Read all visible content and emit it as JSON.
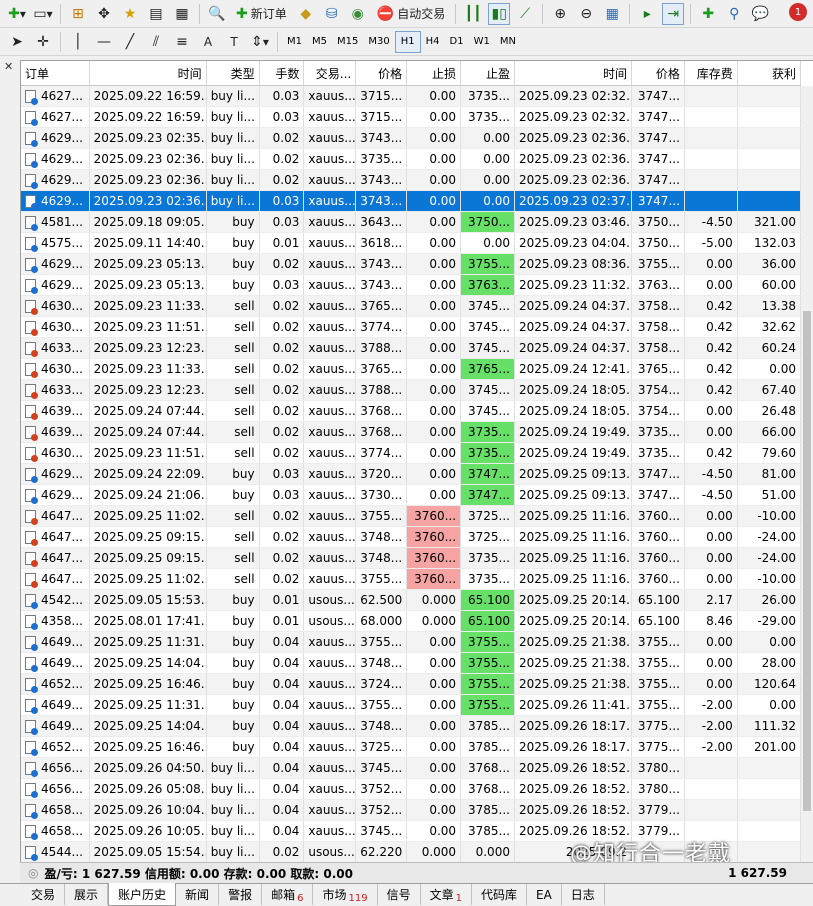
{
  "toolbar": {
    "new_order": "新订单",
    "auto_trading": "自动交易",
    "notification_count": "1",
    "timeframes": [
      "M1",
      "M5",
      "M15",
      "M30",
      "H1",
      "H4",
      "D1",
      "W1",
      "MN"
    ],
    "active_timeframe": "H1"
  },
  "table": {
    "headers": [
      "订单",
      "时间",
      "类型",
      "手数",
      "交易...",
      "价格",
      "止损",
      "止盈",
      "时间",
      "价格",
      "库存费",
      "获利"
    ],
    "rows": [
      {
        "side": "pend",
        "cells": [
          "4627...",
          "2025.09.22 16:59...",
          "buy li...",
          "0.03",
          "xauus...",
          "3715...",
          "0.00",
          "3735...",
          "2025.09.23 02:32...",
          "3747...",
          "",
          ""
        ]
      },
      {
        "side": "pend",
        "cells": [
          "4627...",
          "2025.09.22 16:59...",
          "buy li...",
          "0.03",
          "xauus...",
          "3715...",
          "0.00",
          "3735...",
          "2025.09.23 02:32...",
          "3747...",
          "",
          ""
        ]
      },
      {
        "side": "pend",
        "cells": [
          "4629...",
          "2025.09.23 02:35...",
          "buy li...",
          "0.02",
          "xauus...",
          "3743...",
          "0.00",
          "0.00",
          "2025.09.23 02:36...",
          "3747...",
          "",
          ""
        ]
      },
      {
        "side": "pend",
        "cells": [
          "4629...",
          "2025.09.23 02:36...",
          "buy li...",
          "0.02",
          "xauus...",
          "3735...",
          "0.00",
          "0.00",
          "2025.09.23 02:36...",
          "3747...",
          "",
          ""
        ]
      },
      {
        "side": "pend",
        "cells": [
          "4629...",
          "2025.09.23 02:36...",
          "buy li...",
          "0.02",
          "xauus...",
          "3743...",
          "0.00",
          "0.00",
          "2025.09.23 02:36...",
          "3747...",
          "",
          ""
        ]
      },
      {
        "side": "pend",
        "selected": true,
        "cells": [
          "4629...",
          "2025.09.23 02:36...",
          "buy li...",
          "0.03",
          "xauus...",
          "3743...",
          "0.00",
          "0.00",
          "2025.09.23 02:37...",
          "3747...",
          "",
          ""
        ]
      },
      {
        "side": "buy",
        "tp": "green",
        "cells": [
          "4581...",
          "2025.09.18 09:05...",
          "buy",
          "0.03",
          "xauus...",
          "3643...",
          "0.00",
          "3750...",
          "2025.09.23 03:46...",
          "3750...",
          "-4.50",
          "321.00"
        ]
      },
      {
        "side": "buy",
        "cells": [
          "4575...",
          "2025.09.11 14:40...",
          "buy",
          "0.01",
          "xauus...",
          "3618...",
          "0.00",
          "0.00",
          "2025.09.23 04:04...",
          "3750...",
          "-5.00",
          "132.03"
        ]
      },
      {
        "side": "buy",
        "tp": "green",
        "cells": [
          "4629...",
          "2025.09.23 05:13...",
          "buy",
          "0.02",
          "xauus...",
          "3743...",
          "0.00",
          "3755...",
          "2025.09.23 08:36...",
          "3755...",
          "0.00",
          "36.00"
        ]
      },
      {
        "side": "buy",
        "tp": "green",
        "cells": [
          "4629...",
          "2025.09.23 05:13...",
          "buy",
          "0.03",
          "xauus...",
          "3743...",
          "0.00",
          "3763...",
          "2025.09.23 11:32...",
          "3763...",
          "0.00",
          "60.00"
        ]
      },
      {
        "side": "sell",
        "cells": [
          "4630...",
          "2025.09.23 11:33...",
          "sell",
          "0.02",
          "xauus...",
          "3765...",
          "0.00",
          "3745...",
          "2025.09.24 04:37...",
          "3758...",
          "0.42",
          "13.38"
        ]
      },
      {
        "side": "sell",
        "cells": [
          "4630...",
          "2025.09.23 11:51...",
          "sell",
          "0.02",
          "xauus...",
          "3774...",
          "0.00",
          "3745...",
          "2025.09.24 04:37...",
          "3758...",
          "0.42",
          "32.62"
        ]
      },
      {
        "side": "sell",
        "cells": [
          "4633...",
          "2025.09.23 12:23...",
          "sell",
          "0.02",
          "xauus...",
          "3788...",
          "0.00",
          "3745...",
          "2025.09.24 04:37...",
          "3758...",
          "0.42",
          "60.24"
        ]
      },
      {
        "side": "sell",
        "tp": "green",
        "cells": [
          "4630...",
          "2025.09.23 11:33...",
          "sell",
          "0.02",
          "xauus...",
          "3765...",
          "0.00",
          "3765...",
          "2025.09.24 12:41...",
          "3765...",
          "0.42",
          "0.00"
        ]
      },
      {
        "side": "sell",
        "cells": [
          "4633...",
          "2025.09.23 12:23...",
          "sell",
          "0.02",
          "xauus...",
          "3788...",
          "0.00",
          "3745...",
          "2025.09.24 18:05...",
          "3754...",
          "0.42",
          "67.40"
        ]
      },
      {
        "side": "sell",
        "cells": [
          "4639...",
          "2025.09.24 07:44...",
          "sell",
          "0.02",
          "xauus...",
          "3768...",
          "0.00",
          "3745...",
          "2025.09.24 18:05...",
          "3754...",
          "0.00",
          "26.48"
        ]
      },
      {
        "side": "sell",
        "tp": "green",
        "cells": [
          "4639...",
          "2025.09.24 07:44...",
          "sell",
          "0.02",
          "xauus...",
          "3768...",
          "0.00",
          "3735...",
          "2025.09.24 19:49...",
          "3735...",
          "0.00",
          "66.00"
        ]
      },
      {
        "side": "sell",
        "tp": "green",
        "cells": [
          "4630...",
          "2025.09.23 11:51...",
          "sell",
          "0.02",
          "xauus...",
          "3774...",
          "0.00",
          "3735...",
          "2025.09.24 19:49...",
          "3735...",
          "0.42",
          "79.60"
        ]
      },
      {
        "side": "buy",
        "tp": "green",
        "cells": [
          "4629...",
          "2025.09.24 22:09...",
          "buy",
          "0.03",
          "xauus...",
          "3720...",
          "0.00",
          "3747...",
          "2025.09.25 09:13...",
          "3747...",
          "-4.50",
          "81.00"
        ]
      },
      {
        "side": "buy",
        "tp": "green",
        "cells": [
          "4629...",
          "2025.09.24 21:06...",
          "buy",
          "0.03",
          "xauus...",
          "3730...",
          "0.00",
          "3747...",
          "2025.09.25 09:13...",
          "3747...",
          "-4.50",
          "51.00"
        ]
      },
      {
        "side": "sell",
        "sl": "red",
        "cells": [
          "4647...",
          "2025.09.25 11:02...",
          "sell",
          "0.02",
          "xauus...",
          "3755...",
          "3760...",
          "3725...",
          "2025.09.25 11:16...",
          "3760...",
          "0.00",
          "-10.00"
        ]
      },
      {
        "side": "sell",
        "sl": "red",
        "cells": [
          "4647...",
          "2025.09.25 09:15...",
          "sell",
          "0.02",
          "xauus...",
          "3748...",
          "3760...",
          "3725...",
          "2025.09.25 11:16...",
          "3760...",
          "0.00",
          "-24.00"
        ]
      },
      {
        "side": "sell",
        "sl": "red",
        "cells": [
          "4647...",
          "2025.09.25 09:15...",
          "sell",
          "0.02",
          "xauus...",
          "3748...",
          "3760...",
          "3735...",
          "2025.09.25 11:16...",
          "3760...",
          "0.00",
          "-24.00"
        ]
      },
      {
        "side": "sell",
        "sl": "red",
        "cells": [
          "4647...",
          "2025.09.25 11:02...",
          "sell",
          "0.02",
          "xauus...",
          "3755...",
          "3760...",
          "3735...",
          "2025.09.25 11:16...",
          "3760...",
          "0.00",
          "-10.00"
        ]
      },
      {
        "side": "buy",
        "tp": "green",
        "cells": [
          "4542...",
          "2025.09.05 15:53...",
          "buy",
          "0.01",
          "usous...",
          "62.500",
          "0.000",
          "65.100",
          "2025.09.25 20:14...",
          "65.100",
          "2.17",
          "26.00"
        ]
      },
      {
        "side": "buy",
        "tp": "green",
        "cells": [
          "4358...",
          "2025.08.01 17:41...",
          "buy",
          "0.01",
          "usous...",
          "68.000",
          "0.000",
          "65.100",
          "2025.09.25 20:14...",
          "65.100",
          "8.46",
          "-29.00"
        ]
      },
      {
        "side": "buy",
        "tp": "green",
        "cells": [
          "4649...",
          "2025.09.25 11:31...",
          "buy",
          "0.04",
          "xauus...",
          "3755...",
          "0.00",
          "3755...",
          "2025.09.25 21:38...",
          "3755...",
          "0.00",
          "0.00"
        ]
      },
      {
        "side": "buy",
        "tp": "green",
        "cells": [
          "4649...",
          "2025.09.25 14:04...",
          "buy",
          "0.04",
          "xauus...",
          "3748...",
          "0.00",
          "3755...",
          "2025.09.25 21:38...",
          "3755...",
          "0.00",
          "28.00"
        ]
      },
      {
        "side": "buy",
        "tp": "green",
        "cells": [
          "4652...",
          "2025.09.25 16:46...",
          "buy",
          "0.04",
          "xauus...",
          "3724...",
          "0.00",
          "3755...",
          "2025.09.25 21:38...",
          "3755...",
          "0.00",
          "120.64"
        ]
      },
      {
        "side": "buy",
        "tp": "green",
        "cells": [
          "4649...",
          "2025.09.25 11:31...",
          "buy",
          "0.04",
          "xauus...",
          "3755...",
          "0.00",
          "3755...",
          "2025.09.26 11:41...",
          "3755...",
          "-2.00",
          "0.00"
        ]
      },
      {
        "side": "buy",
        "cells": [
          "4649...",
          "2025.09.25 14:04...",
          "buy",
          "0.04",
          "xauus...",
          "3748...",
          "0.00",
          "3785...",
          "2025.09.26 18:17...",
          "3775...",
          "-2.00",
          "111.32"
        ]
      },
      {
        "side": "buy",
        "cells": [
          "4652...",
          "2025.09.25 16:46...",
          "buy",
          "0.04",
          "xauus...",
          "3725...",
          "0.00",
          "3785...",
          "2025.09.26 18:17...",
          "3775...",
          "-2.00",
          "201.00"
        ]
      },
      {
        "side": "pend",
        "cells": [
          "4656...",
          "2025.09.26 04:50...",
          "buy li...",
          "0.04",
          "xauus...",
          "3745...",
          "0.00",
          "3768...",
          "2025.09.26 18:52...",
          "3780...",
          "",
          ""
        ]
      },
      {
        "side": "pend",
        "cells": [
          "4656...",
          "2025.09.26 05:08...",
          "buy li...",
          "0.04",
          "xauus...",
          "3752...",
          "0.00",
          "3768...",
          "2025.09.26 18:52...",
          "3780...",
          "",
          ""
        ]
      },
      {
        "side": "pend",
        "cells": [
          "4658...",
          "2025.09.26 10:04...",
          "buy li...",
          "0.04",
          "xauus...",
          "3752...",
          "0.00",
          "3785...",
          "2025.09.26 18:52...",
          "3779...",
          "",
          ""
        ]
      },
      {
        "side": "pend",
        "cells": [
          "4658...",
          "2025.09.26 10:05...",
          "buy li...",
          "0.04",
          "xauus...",
          "3745...",
          "0.00",
          "3785...",
          "2025.09.26 18:52...",
          "3779...",
          "",
          ""
        ]
      },
      {
        "side": "pend",
        "cells": [
          "4544...",
          "2025.09.05 15:54...",
          "buy li...",
          "0.02",
          "usous...",
          "62.220",
          "0.000",
          "0.000",
          "2025.09.2",
          "",
          "",
          ""
        ]
      }
    ]
  },
  "status": {
    "summary": "盈/亏: 1 627.59  信用额: 0.00  存款: 0.00  取款: 0.00",
    "total": "1 627.59"
  },
  "watermark": "@知行合一老戴",
  "tabs": [
    {
      "label": "交易",
      "count": ""
    },
    {
      "label": "展示",
      "count": ""
    },
    {
      "label": "账户历史",
      "count": "",
      "active": true
    },
    {
      "label": "新闻",
      "count": ""
    },
    {
      "label": "警报",
      "count": ""
    },
    {
      "label": "邮箱",
      "count": "6"
    },
    {
      "label": "市场",
      "count": "119"
    },
    {
      "label": "信号",
      "count": ""
    },
    {
      "label": "文章",
      "count": "1"
    },
    {
      "label": "代码库",
      "count": ""
    },
    {
      "label": "EA",
      "count": ""
    },
    {
      "label": "日志",
      "count": ""
    }
  ]
}
